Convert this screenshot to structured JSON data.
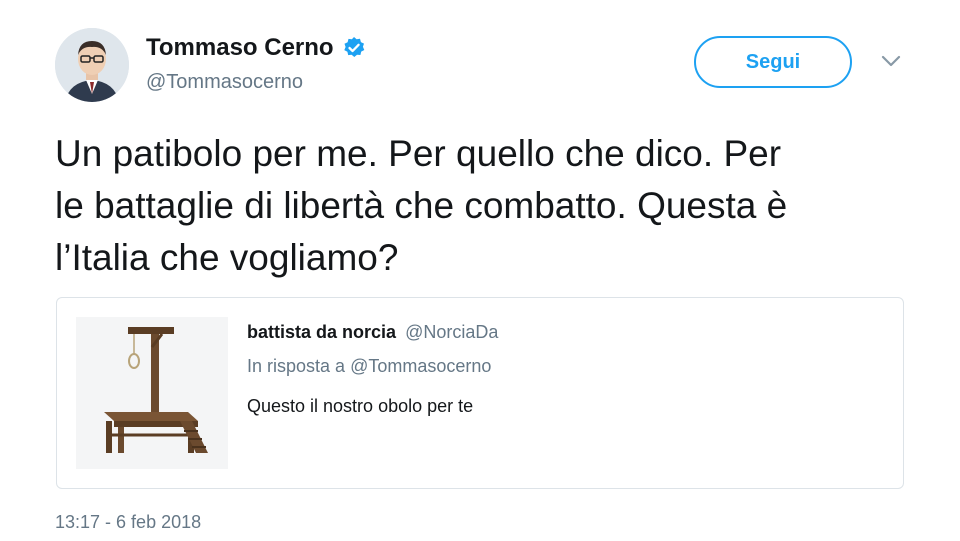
{
  "author": {
    "display_name": "Tommaso Cerno",
    "handle": "@Tommasocerno",
    "verified": true
  },
  "actions": {
    "follow_label": "Segui",
    "more_icon": "chevron-down-icon"
  },
  "tweet": {
    "line1": "Un patibolo per me. Per quello che dico. Per",
    "line2": "le battaglie di libertà che combatto. Questa è",
    "line3": "l’Italia che vogliamo?",
    "timestamp": "13:17 - 6 feb 2018"
  },
  "quoted_tweet": {
    "author_name": "battista da norcia",
    "author_handle": "@NorciaDa",
    "reply_prefix": "In risposta a",
    "reply_mention": "@Tommasocerno",
    "text": "Questo il nostro obolo per te",
    "media": "gallows-image"
  },
  "colors": {
    "accent": "#1da1f2",
    "text_primary": "#14171a",
    "text_secondary": "#657786",
    "border": "#dde3e8"
  }
}
